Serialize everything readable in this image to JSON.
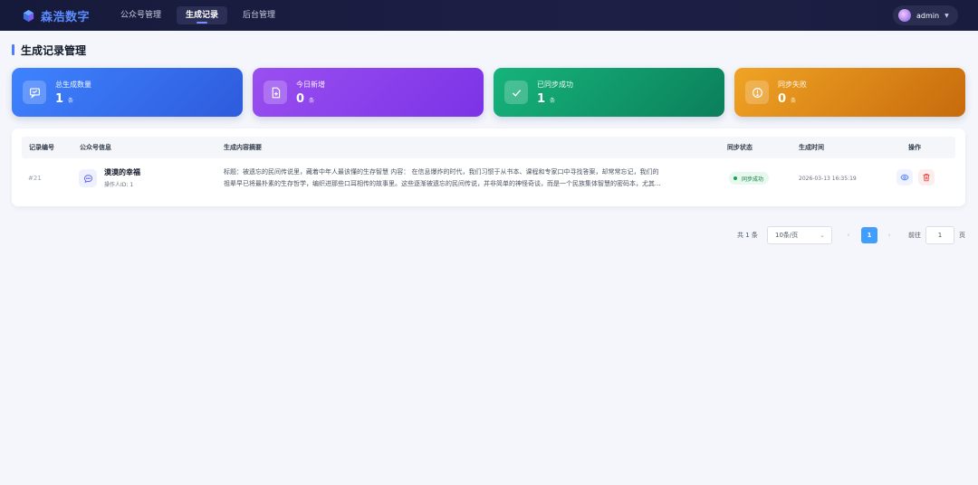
{
  "app": {
    "brand": "森浩数字",
    "nav": [
      "公众号管理",
      "生成记录",
      "后台管理"
    ],
    "user": "admin",
    "accent": "#4f7cff"
  },
  "page": {
    "title": "生成记录管理"
  },
  "stats": [
    {
      "label": "总生成数量",
      "value": "1",
      "unit": "条",
      "icon": "chat-icon",
      "color": "#3f83ff"
    },
    {
      "label": "今日新增",
      "value": "0",
      "unit": "条",
      "icon": "file-plus-icon",
      "color": "#9a4ff0"
    },
    {
      "label": "已同步成功",
      "value": "1",
      "unit": "条",
      "icon": "check-icon",
      "color": "#16b47c"
    },
    {
      "label": "同步失败",
      "value": "0",
      "unit": "条",
      "icon": "info-circle-icon",
      "color": "#f0a424"
    }
  ],
  "table": {
    "headers": [
      "记录编号",
      "公众号信息",
      "生成内容摘要",
      "同步状态",
      "生成时间",
      "操作"
    ],
    "rows": [
      {
        "id": "#21",
        "account_name": "漠漠的幸福",
        "operator": "操作人ID: 1",
        "summary_line1": "标题：被遗忘的民间传说里，藏着中年人最该懂的生存智慧 内容： 在信息爆炸的时代，我们习惯于从书本、课程和专家口中寻找答案，却常常忘记，我们的",
        "summary_line2": "祖辈早已将最朴素的生存哲学，编织进那些口耳相传的故事里。这些逐渐被遗忘的民间传说，并非简单的神怪奇谈，而是一个民族集体智慧的密码本，尤其...",
        "status": "同步成功",
        "time": "2026-03-13 16:35:19"
      }
    ]
  },
  "pagination": {
    "total": "共 1 条",
    "page_size": "10条/页",
    "current": "1",
    "goto_label": "前往",
    "goto_value": "1",
    "suffix": "页"
  }
}
